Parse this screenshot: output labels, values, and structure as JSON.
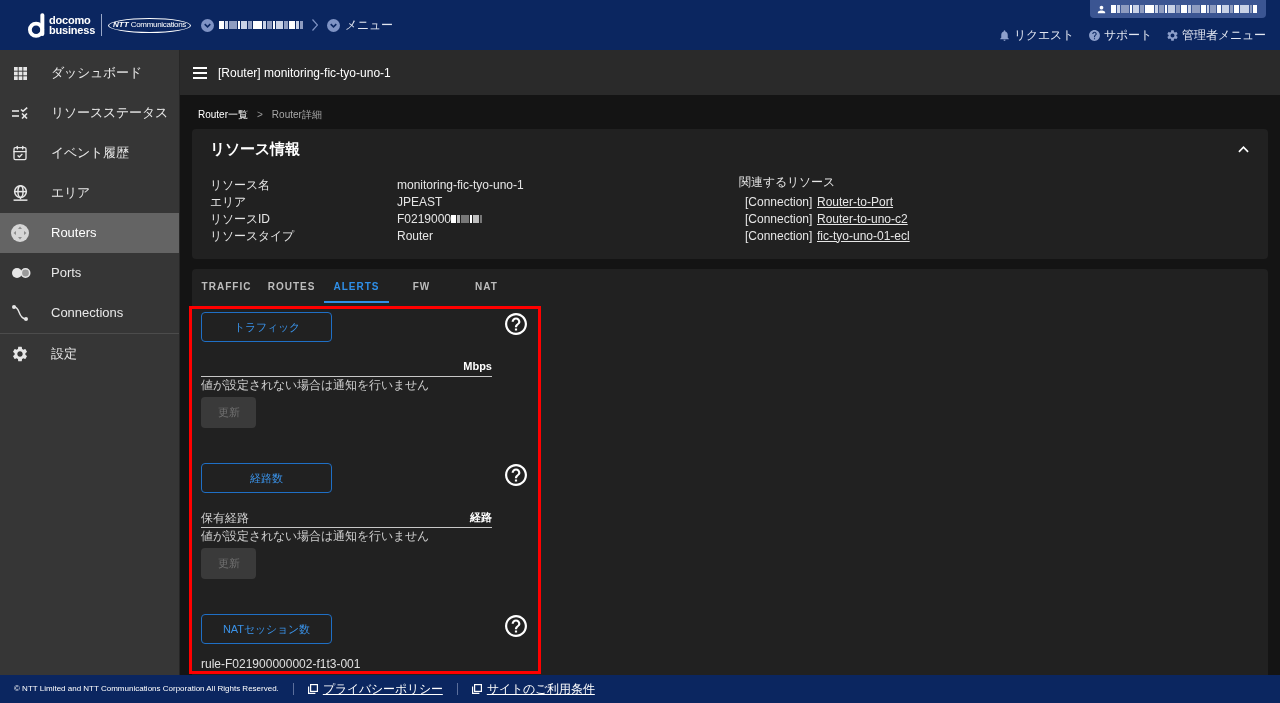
{
  "header": {
    "logo": {
      "brand": [
        "docomo",
        "business"
      ],
      "partner": {
        "mark": "NTT",
        "name": "Communications"
      }
    },
    "breadcrumb": [
      {
        "kind": "blurred"
      },
      {
        "kind": "text",
        "label": "メニュー"
      }
    ],
    "user": {
      "kind": "blurred"
    },
    "links": [
      {
        "label": "リクエスト"
      },
      {
        "label": "サポート"
      },
      {
        "label": "管理者メニュー"
      }
    ]
  },
  "sidebar": {
    "groups": [
      [
        {
          "label": "ダッシュボード",
          "selected": false
        },
        {
          "label": "リソースステータス",
          "selected": false
        },
        {
          "label": "イベント履歴",
          "selected": false
        },
        {
          "label": "エリア",
          "selected": false
        },
        {
          "label": "Routers",
          "selected": true
        },
        {
          "label": "Ports",
          "selected": false
        },
        {
          "label": "Connections",
          "selected": false
        }
      ],
      [
        {
          "label": "設定",
          "selected": false
        }
      ]
    ]
  },
  "page_title": "[Router] monitoring-fic-tyo-uno-1",
  "breadcrumb": {
    "separator": ">",
    "items": [
      {
        "label": "Router一覧",
        "current": false
      },
      {
        "label": "Router詳細",
        "current": true
      }
    ]
  },
  "resource_info": {
    "title": "リソース情報",
    "expanded": true,
    "fields": [
      {
        "label": "リソース名",
        "value": "monitoring-fic-tyo-uno-1",
        "blurred": false
      },
      {
        "label": "エリア",
        "value": "JPEAST",
        "blurred": false
      },
      {
        "label": "リソースID",
        "value": "F0219000",
        "blurred": true
      },
      {
        "label": "リソースタイプ",
        "value": "Router",
        "blurred": false
      }
    ],
    "related": {
      "title": "関連するリソース",
      "items": [
        {
          "type": "[Connection]",
          "name": "Router-to-Port"
        },
        {
          "type": "[Connection]",
          "name": "Router-to-uno-c2"
        },
        {
          "type": "[Connection]",
          "name": "fic-tyo-uno-01-ecl"
        }
      ]
    }
  },
  "tabs": [
    {
      "label": "TRAFFIC",
      "selected": false
    },
    {
      "label": "ROUTES",
      "selected": false
    },
    {
      "label": "ALERTS",
      "selected": true
    },
    {
      "label": "FW",
      "selected": false
    },
    {
      "label": "NAT",
      "selected": false
    }
  ],
  "alerts_panel": {
    "highlighted": true,
    "sections": [
      {
        "kind": "threshold",
        "title": "トラフィック",
        "field": {
          "suffix": "Mbps"
        },
        "hint": "値が設定されない場合は通知を行いません",
        "button": {
          "label": "更新",
          "disabled": true
        }
      },
      {
        "kind": "threshold",
        "title": "経路数",
        "field": {
          "placeholder": "保有経路",
          "suffix": "経路"
        },
        "hint": "値が設定されない場合は通知を行いません",
        "button": {
          "label": "更新",
          "disabled": true
        }
      },
      {
        "kind": "rules",
        "title": "NATセッション数",
        "rules": [
          "rule-F021900000002-f1t3-001"
        ]
      }
    ]
  },
  "footer": {
    "copyright": "© NTT Limited and NTT Communications Corporation All Rights Reserved.",
    "links": [
      {
        "label": "プライバシーポリシー"
      },
      {
        "label": "サイトのご利用条件"
      }
    ]
  }
}
